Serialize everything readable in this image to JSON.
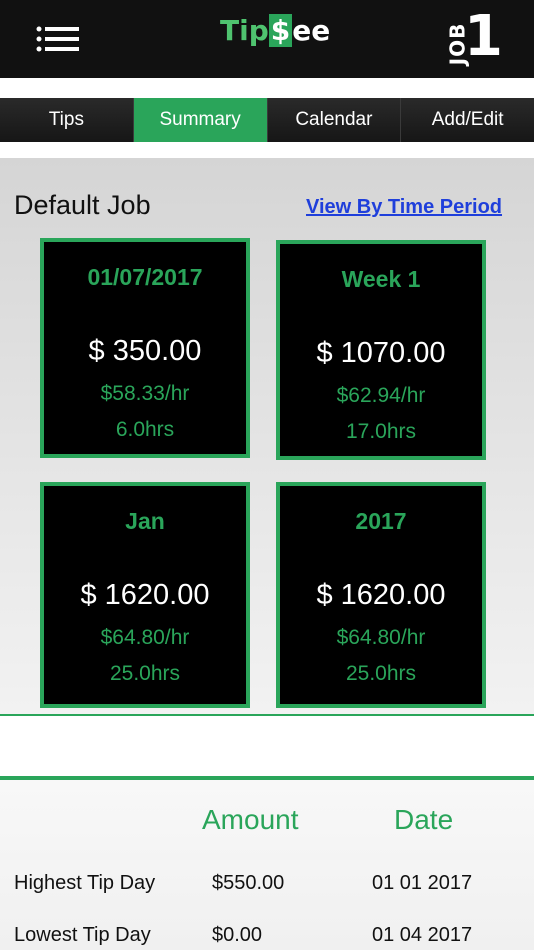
{
  "header": {
    "logo_left": "Tip",
    "logo_dollar": "$",
    "logo_right": "ee",
    "job_label": "JOB",
    "job_number": "1"
  },
  "tabs": [
    {
      "label": "Tips"
    },
    {
      "label": "Summary"
    },
    {
      "label": "Calendar"
    },
    {
      "label": "Add/Edit"
    }
  ],
  "summary": {
    "job_title": "Default Job",
    "view_link": "View By Time Period",
    "cards": [
      {
        "title": "01/07/2017",
        "amount": "$ 350.00",
        "rate": "$58.33/hr",
        "hours": "6.0hrs"
      },
      {
        "title": "Week 1",
        "amount": "$ 1070.00",
        "rate": "$62.94/hr",
        "hours": "17.0hrs"
      },
      {
        "title": "Jan",
        "amount": "$ 1620.00",
        "rate": "$64.80/hr",
        "hours": "25.0hrs"
      },
      {
        "title": "2017",
        "amount": "$ 1620.00",
        "rate": "$64.80/hr",
        "hours": "25.0hrs"
      }
    ]
  },
  "stats": {
    "col_amount": "Amount",
    "col_date": "Date",
    "rows": [
      {
        "label": "Highest Tip Day",
        "amount": "$550.00",
        "date": "01 01 2017"
      },
      {
        "label": "Lowest Tip Day",
        "amount": "$0.00",
        "date": "01 04 2017"
      }
    ]
  },
  "colors": {
    "accent": "#2aa55a",
    "header_bg": "#111111",
    "link": "#1f3fdb"
  }
}
